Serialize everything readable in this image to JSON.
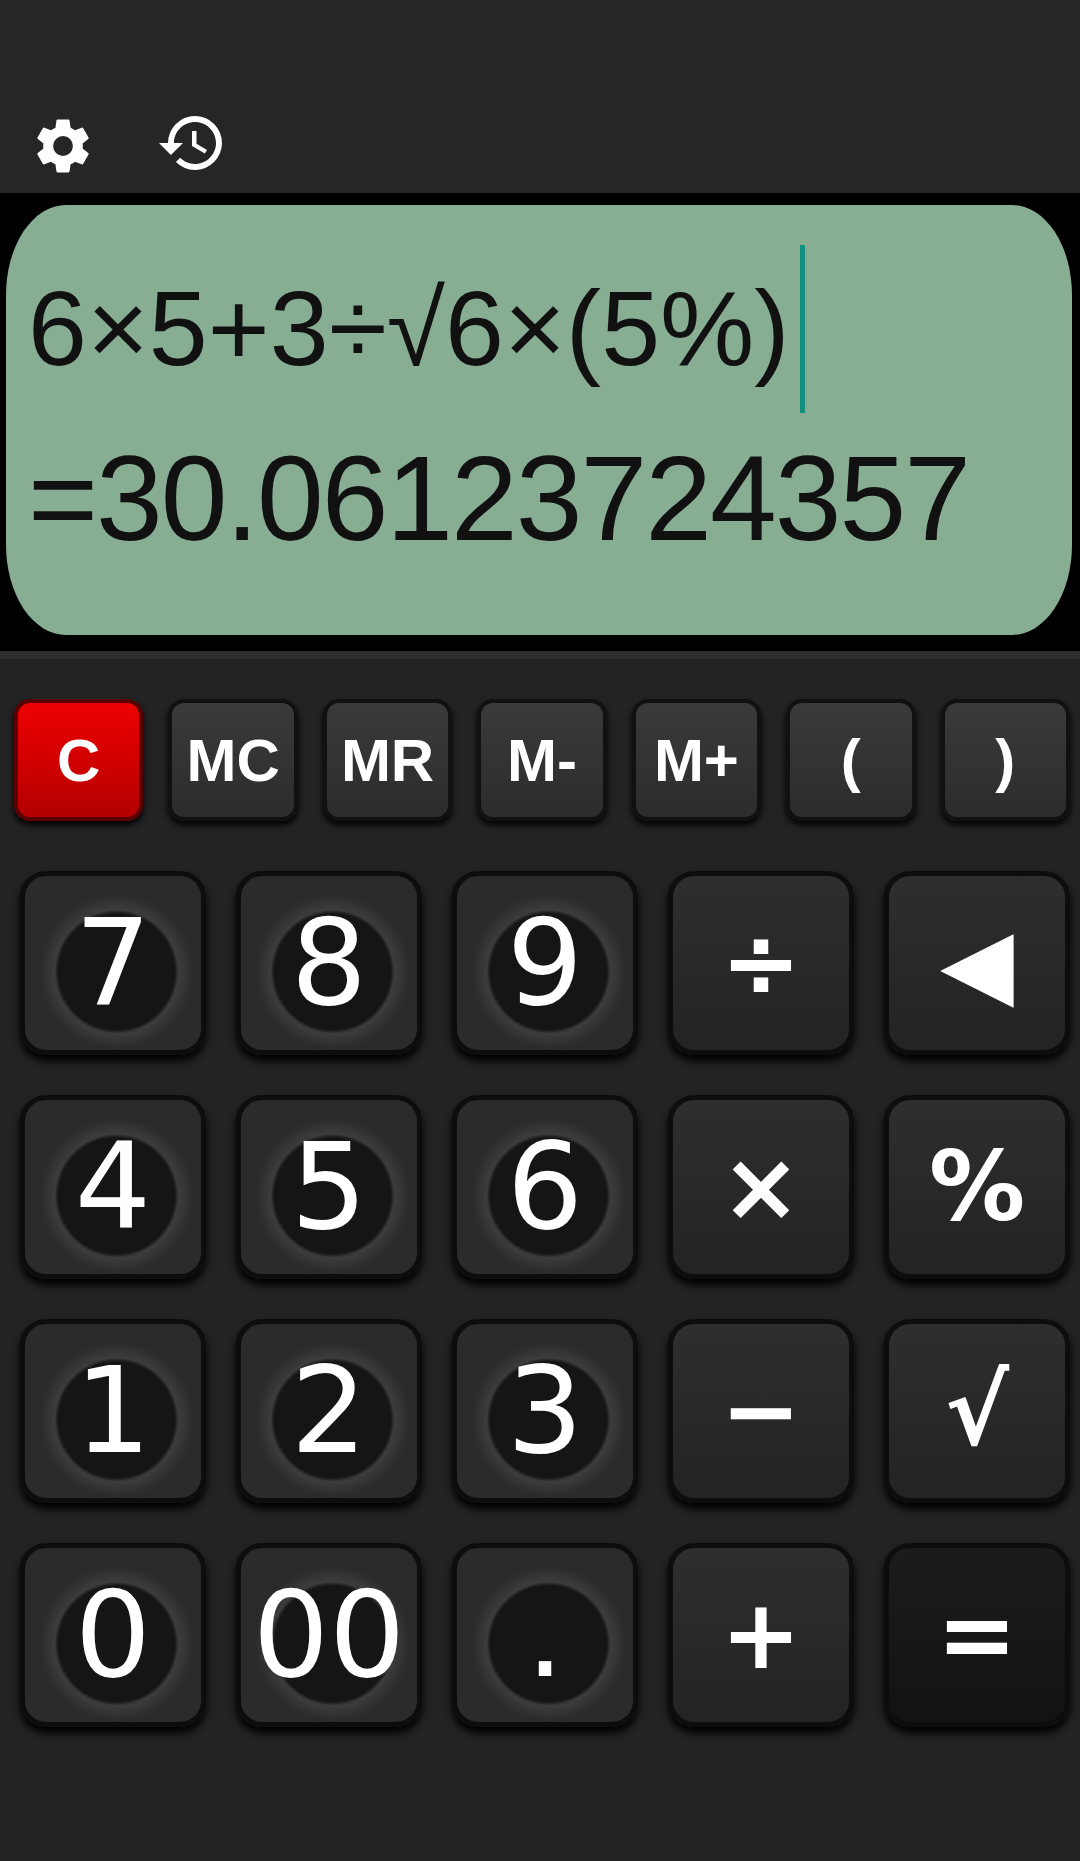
{
  "display": {
    "expression": "6×5+3÷√6×(5%)",
    "result": "=30.06123724357"
  },
  "function_keys": [
    {
      "label": "C",
      "kind": "clear"
    },
    {
      "label": "MC",
      "kind": "memory"
    },
    {
      "label": "MR",
      "kind": "memory"
    },
    {
      "label": "M-",
      "kind": "memory"
    },
    {
      "label": "M+",
      "kind": "memory"
    },
    {
      "label": "(",
      "kind": "memory"
    },
    {
      "label": ")",
      "kind": "memory"
    }
  ],
  "keys": [
    {
      "label": "7",
      "kind": "digit"
    },
    {
      "label": "8",
      "kind": "digit"
    },
    {
      "label": "9",
      "kind": "digit"
    },
    {
      "label": "÷",
      "kind": "operator"
    },
    {
      "label": "◀",
      "kind": "operator"
    },
    {
      "label": "4",
      "kind": "digit"
    },
    {
      "label": "5",
      "kind": "digit"
    },
    {
      "label": "6",
      "kind": "digit"
    },
    {
      "label": "×",
      "kind": "operator"
    },
    {
      "label": "%",
      "kind": "operator"
    },
    {
      "label": "1",
      "kind": "digit"
    },
    {
      "label": "2",
      "kind": "digit"
    },
    {
      "label": "3",
      "kind": "digit"
    },
    {
      "label": "−",
      "kind": "operator"
    },
    {
      "label": "√",
      "kind": "operator"
    },
    {
      "label": "0",
      "kind": "digit"
    },
    {
      "label": "00",
      "kind": "digit"
    },
    {
      "label": ".",
      "kind": "digit"
    },
    {
      "label": "+",
      "kind": "operator"
    },
    {
      "label": "=",
      "kind": "equals"
    }
  ]
}
